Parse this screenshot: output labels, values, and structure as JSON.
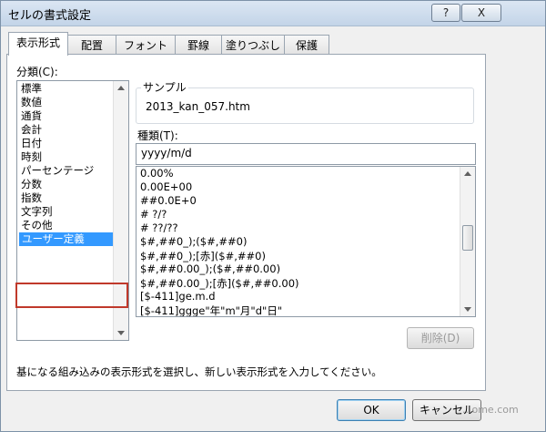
{
  "window": {
    "title": "セルの書式設定",
    "help_label": "?",
    "close_label": "X"
  },
  "tabs": [
    "表示形式",
    "配置",
    "フォント",
    "罫線",
    "塗りつぶし",
    "保護"
  ],
  "category": {
    "label": "分類(C):",
    "items": [
      "標準",
      "数値",
      "通貨",
      "会計",
      "日付",
      "時刻",
      "パーセンテージ",
      "分数",
      "指数",
      "文字列",
      "その他",
      "ユーザー定義"
    ],
    "selected": "ユーザー定義"
  },
  "sample": {
    "label": "サンプル",
    "value": "2013_kan_057.htm"
  },
  "type": {
    "label": "種類(T):",
    "value": "yyyy/m/d",
    "formats": [
      "0.00%",
      "0.00E+00",
      "##0.0E+0",
      "# ?/?",
      "# ??/??",
      "$#,##0_);($#,##0)",
      "$#,##0_);[赤]($#,##0)",
      "$#,##0.00_);($#,##0.00)",
      "$#,##0.00_);[赤]($#,##0.00)",
      "[$-411]ge.m.d",
      "[$-411]ggge\"年\"m\"月\"d\"日\""
    ]
  },
  "delete_label": "削除(D)",
  "description": "基になる組み込みの表示形式を選択し、新しい表示形式を入力してください。",
  "ok_label": "OK",
  "cancel_label": "キャンセル",
  "watermark": "...ome.com"
}
